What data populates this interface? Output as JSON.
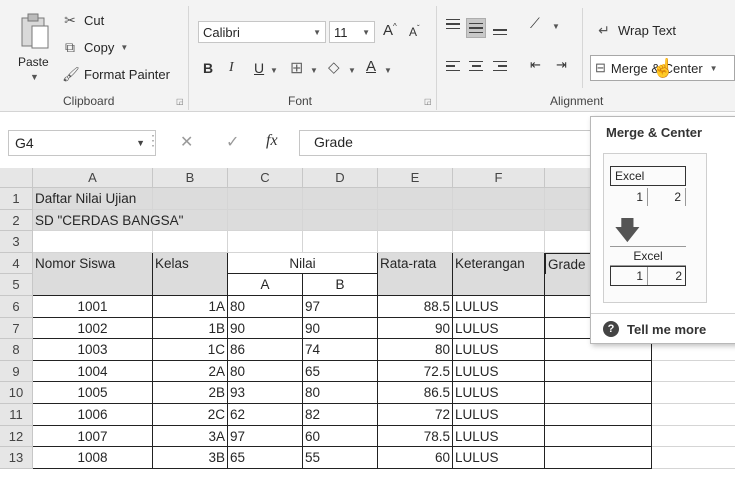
{
  "ribbon": {
    "clipboard": {
      "paste": "Paste",
      "cut": "Cut",
      "copy": "Copy",
      "format_painter": "Format Painter",
      "group_label": "Clipboard"
    },
    "font": {
      "font_name": "Calibri",
      "font_size": "11",
      "bold": "B",
      "italic": "I",
      "underline": "U",
      "increase_size": "A",
      "decrease_size": "A",
      "font_color": "A",
      "group_label": "Font"
    },
    "alignment": {
      "wrap_text": "Wrap Text",
      "merge_center": "Merge & Center",
      "group_label": "Alignment"
    }
  },
  "formula_bar": {
    "name_box": "G4",
    "formula": "Grade",
    "fx_label": "fx"
  },
  "grid": {
    "columns": [
      "A",
      "B",
      "C",
      "D",
      "E",
      "F"
    ],
    "rows": [
      "1",
      "2",
      "3",
      "4",
      "5",
      "6",
      "7",
      "8",
      "9",
      "10",
      "11",
      "12",
      "13"
    ],
    "title_line1": "Daftar Nilai Ujian",
    "title_line2": "SD \"CERDAS BANGSA\"",
    "headers": {
      "nomor": "Nomor Siswa",
      "kelas": "Kelas",
      "nilai": "Nilai",
      "nilai_a": "A",
      "nilai_b": "B",
      "rata": "Rata-rata",
      "keterangan": "Keterangan",
      "grade": "Grade"
    },
    "data_rows": [
      {
        "nomor": "1001",
        "kelas": "1A",
        "a": "80",
        "b": "97",
        "rata": "88.5",
        "ket": "LULUS"
      },
      {
        "nomor": "1002",
        "kelas": "1B",
        "a": "90",
        "b": "90",
        "rata": "90",
        "ket": "LULUS"
      },
      {
        "nomor": "1003",
        "kelas": "1C",
        "a": "86",
        "b": "74",
        "rata": "80",
        "ket": "LULUS"
      },
      {
        "nomor": "1004",
        "kelas": "2A",
        "a": "80",
        "b": "65",
        "rata": "72.5",
        "ket": "LULUS"
      },
      {
        "nomor": "1005",
        "kelas": "2B",
        "a": "93",
        "b": "80",
        "rata": "86.5",
        "ket": "LULUS"
      },
      {
        "nomor": "1006",
        "kelas": "2C",
        "a": "62",
        "b": "82",
        "rata": "72",
        "ket": "LULUS"
      },
      {
        "nomor": "1007",
        "kelas": "3A",
        "a": "97",
        "b": "60",
        "rata": "78.5",
        "ket": "LULUS"
      },
      {
        "nomor": "1008",
        "kelas": "3B",
        "a": "65",
        "b": "55",
        "rata": "60",
        "ket": "LULUS"
      }
    ]
  },
  "tooltip": {
    "title": "Merge & Center",
    "illus_top_text": "Excel",
    "illus_top_n1": "1",
    "illus_top_n2": "2",
    "illus_bottom_text": "Excel",
    "illus_bottom_n1": "1",
    "illus_bottom_n2": "2",
    "tell_me_more": "Tell me more"
  },
  "colors": {
    "ribbon_bg": "#f3f3f3",
    "header_bg": "#e6e6e6",
    "shaded_cell": "#dcdcdc"
  },
  "icons": [
    "clipboard-icon",
    "scissors-icon",
    "copy-icon",
    "brush-icon",
    "wrap-text-icon",
    "merge-icon",
    "help-icon",
    "cancel-icon",
    "check-icon"
  ]
}
